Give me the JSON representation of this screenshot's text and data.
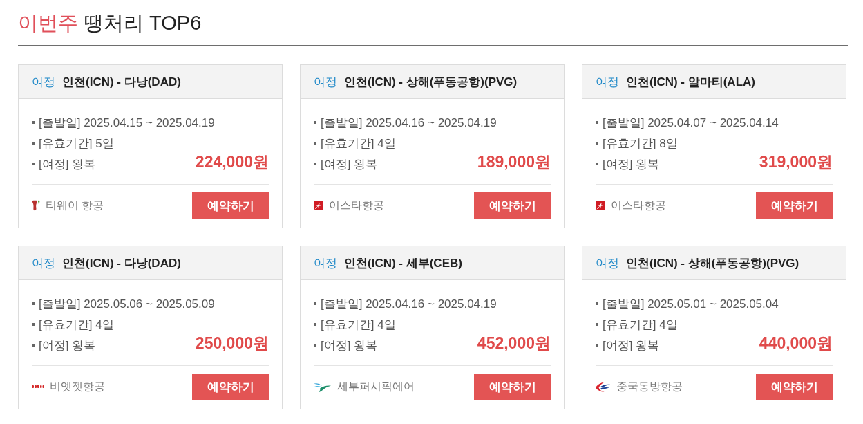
{
  "heading": {
    "highlight": "이번주",
    "rest": "땡처리 TOP6"
  },
  "deals": [
    {
      "tag": "여정",
      "route": "인천(ICN) - 다낭(DAD)",
      "details": [
        "[출발일] 2025.04.15 ~ 2025.04.19",
        "[유효기간] 5일",
        "[여정] 왕복"
      ],
      "price": "224,000원",
      "airline": {
        "name": "티웨이 항공",
        "kind": "tway"
      },
      "button": "예약하기"
    },
    {
      "tag": "여정",
      "route": "인천(ICN) - 상해(푸동공항)(PVG)",
      "details": [
        "[출발일] 2025.04.16 ~ 2025.04.19",
        "[유효기간] 4일",
        "[여정] 왕복"
      ],
      "price": "189,000원",
      "airline": {
        "name": "이스타항공",
        "kind": "eastar"
      },
      "button": "예약하기"
    },
    {
      "tag": "여정",
      "route": "인천(ICN) - 알마티(ALA)",
      "details": [
        "[출발일] 2025.04.07 ~ 2025.04.14",
        "[유효기간] 8일",
        "[여정] 왕복"
      ],
      "price": "319,000원",
      "airline": {
        "name": "이스타항공",
        "kind": "eastar"
      },
      "button": "예약하기"
    },
    {
      "tag": "여정",
      "route": "인천(ICN) - 다낭(DAD)",
      "details": [
        "[출발일] 2025.05.06 ~ 2025.05.09",
        "[유효기간] 4일",
        "[여정] 왕복"
      ],
      "price": "250,000원",
      "airline": {
        "name": "비엣젯항공",
        "kind": "vietjet"
      },
      "button": "예약하기"
    },
    {
      "tag": "여정",
      "route": "인천(ICN) - 세부(CEB)",
      "details": [
        "[출발일] 2025.04.16 ~ 2025.04.19",
        "[유효기간] 4일",
        "[여정] 왕복"
      ],
      "price": "452,000원",
      "airline": {
        "name": "세부퍼시픽에어",
        "kind": "cebu"
      },
      "button": "예약하기"
    },
    {
      "tag": "여정",
      "route": "인천(ICN) - 상해(푸동공항)(PVG)",
      "details": [
        "[출발일] 2025.05.01 ~ 2025.05.04",
        "[유효기간] 4일",
        "[여정] 왕복"
      ],
      "price": "440,000원",
      "airline": {
        "name": "중국동방항공",
        "kind": "china-eastern"
      },
      "button": "예약하기"
    }
  ]
}
